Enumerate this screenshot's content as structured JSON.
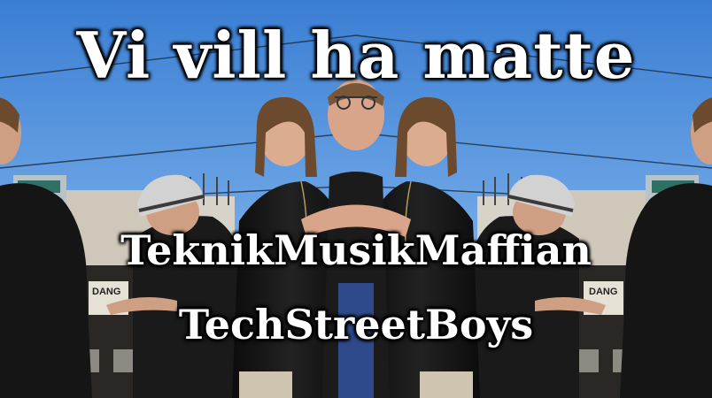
{
  "captions": {
    "title": "Vi vill ha matte",
    "line1": "TeknikMusikMaffian",
    "line2": "TechStreetBoys"
  },
  "scene": {
    "sign_text": "DANG",
    "colors": {
      "sky_top": "#3e82d6",
      "sky_bottom": "#a9cdf1",
      "jacket": "#141414",
      "skin": "#d9a58a",
      "beanie": "#d2d2d2",
      "building": "#c9c1b4"
    }
  }
}
